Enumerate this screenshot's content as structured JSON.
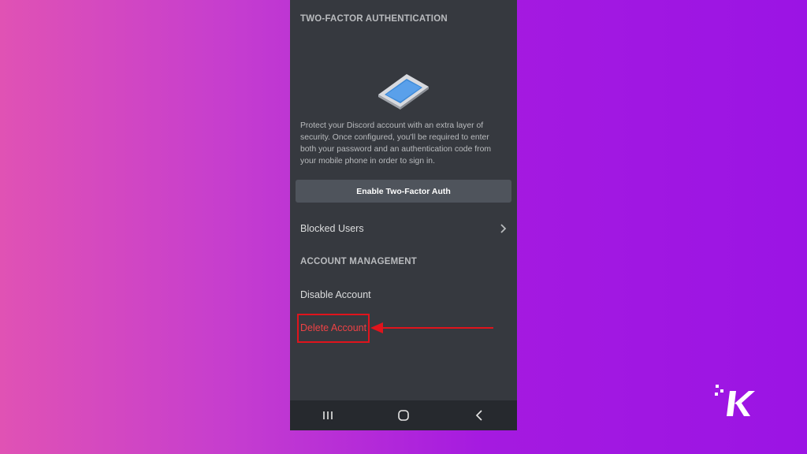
{
  "two_factor": {
    "header": "TWO-FACTOR AUTHENTICATION",
    "description": "Protect your Discord account with an extra layer of security. Once configured, you'll be required to enter both your password and an authentication code from your mobile phone in order to sign in.",
    "enable_button_label": "Enable Two-Factor Auth",
    "illustration_icon": "phone-illustration-icon"
  },
  "blocked_users": {
    "label": "Blocked Users",
    "icon": "chevron-right-icon"
  },
  "account_management": {
    "header": "ACCOUNT MANAGEMENT",
    "disable_label": "Disable Account",
    "delete_label": "Delete Account"
  },
  "annotation": {
    "highlight_color": "#e0141c"
  },
  "nav_bar": {
    "icons": [
      "recent-apps-icon",
      "home-icon",
      "back-icon"
    ]
  },
  "colors": {
    "panel_bg": "#36393f",
    "button_bg": "#4f545c",
    "danger_text": "#ed4245",
    "muted_text": "#b9bbbe"
  },
  "watermark_logo": "K"
}
